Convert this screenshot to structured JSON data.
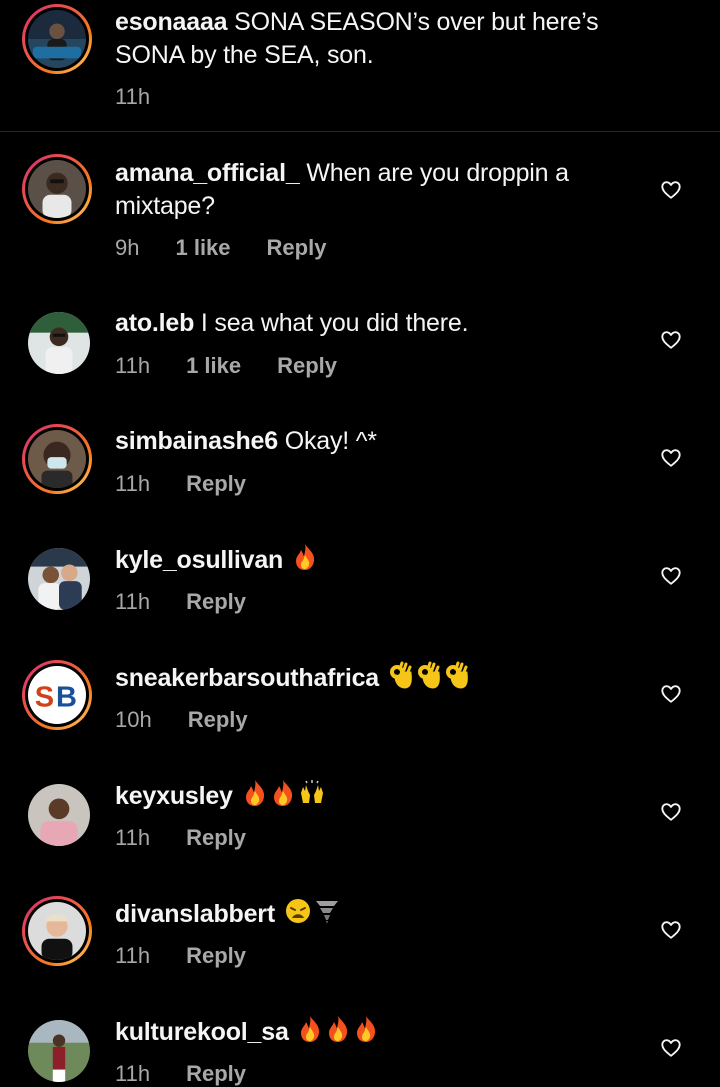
{
  "caption": {
    "username": "esonaaaa",
    "text": "SONA SEASON’s over but here’s SONA by the SEA, son.",
    "time": "11h"
  },
  "comments": [
    {
      "username": "amana_official_",
      "text": "When are you droppin a mixtape?",
      "time": "9h",
      "likes": "1 like",
      "reply": "Reply"
    },
    {
      "username": "ato.leb",
      "text": "I sea what you did there.",
      "time": "11h",
      "likes": "1 like",
      "reply": "Reply"
    },
    {
      "username": "simbainashe6",
      "text": "Okay! ^*",
      "time": "11h",
      "reply": "Reply"
    },
    {
      "username": "kyle_osullivan",
      "emojis": [
        "fire-emoji"
      ],
      "time": "11h",
      "reply": "Reply"
    },
    {
      "username": "sneakerbarsouthafrica",
      "emojis": [
        "ok-hand-emoji",
        "ok-hand-emoji",
        "ok-hand-emoji"
      ],
      "time": "10h",
      "reply": "Reply"
    },
    {
      "username": "keyxusley",
      "emojis": [
        "fire-emoji",
        "fire-emoji",
        "raising-hands-emoji"
      ],
      "time": "11h",
      "reply": "Reply"
    },
    {
      "username": "divanslabbert",
      "emojis": [
        "weary-face-emoji",
        "tornado-emoji"
      ],
      "time": "11h",
      "reply": "Reply"
    },
    {
      "username": "kulturekool_sa",
      "emojis": [
        "fire-emoji",
        "fire-emoji",
        "fire-emoji"
      ],
      "time": "11h",
      "reply": "Reply"
    }
  ],
  "avatar_sb_logo": {
    "line1": "S",
    "line2": "B"
  },
  "colors": {
    "background": "#000000",
    "text": "#f5f5f5",
    "secondary": "#a8a8a8",
    "divider": "#262626",
    "story_ring_start": "#d62976",
    "story_ring_end": "#feda75"
  },
  "icons": {
    "like": "heart-outline-icon"
  }
}
